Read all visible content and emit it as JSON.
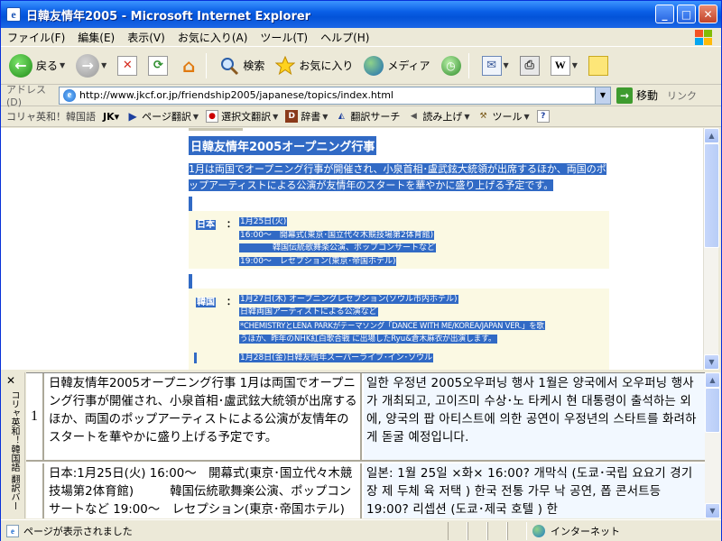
{
  "window": {
    "title": "日韓友情年2005 - Microsoft Internet Explorer",
    "app_icon": "ie-page-icon",
    "minimize": "_",
    "maximize": "□",
    "close": "✕"
  },
  "menu": [
    "ファイル(F)",
    "編集(E)",
    "表示(V)",
    "お気に入り(A)",
    "ツール(T)",
    "ヘルプ(H)"
  ],
  "toolbar": {
    "back_label": "戻る",
    "search_label": "検索",
    "favorites_label": "お気に入り",
    "media_label": "メディア"
  },
  "address": {
    "label": "アドレス(D)",
    "url": "http://www.jkcf.or.jp/friendship2005/japanese/topics/index.html",
    "go_label": "移動",
    "links_label": "リンク"
  },
  "korea_toolbar": {
    "brand": "コリャ英和！韓国語",
    "jk": "JK▾",
    "page_translate": "ページ翻訳",
    "selection_translate": "選択文翻訳",
    "dictionary": "辞書",
    "translate_search": "翻訳サーチ",
    "read_aloud": "読み上げ",
    "tools": "ツール"
  },
  "page": {
    "title": "日韓友情年2005オープニング行事",
    "desc": "1月は両国でオープニング行事が開催され、小泉首相･盧武鉉大統領が出席するほか、両国のポップアーティストによる公演が友情年のスタートを華やかに盛り上げる予定です。",
    "japan": {
      "country": "日本",
      "colon": "：",
      "rows": [
        "1月25日(火)",
        "16:00～　開幕式(東京･国立代々木競技場第2体育館)",
        "　　　　韓国伝統歌舞楽公演、ポップコンサートなど",
        "19:00～　レセプション(東京･帝国ホテル)"
      ]
    },
    "korea": {
      "country": "韓国",
      "colon": "：",
      "rows": [
        "1月27日(木) オープニングレセプション(ソウル市内ホテル)",
        "日韓両国アーティストによる公演など",
        "*CHEMISTRYとLENA PARKがテーマソング「DANCE WITH ME/KOREA/JAPAN VER.」を歌",
        "うほか、昨年のNHK紅白歌合戦 に出場したRyu&倉木麻衣が出演します。",
        "1月28日(金)日韓友情年スーパーライブ･イン･ソウル"
      ]
    }
  },
  "translation_pane": {
    "close": "✕",
    "sidebar_label": "コリャ英和！韓国語 翻訳バー",
    "rows": [
      {
        "num": "1",
        "ja": "日韓友情年2005オープニング行事 1月は両国でオープニング行事が開催され、小泉首相･盧武鉉大統領が出席するほか、両国のポップアーティストによる公演が友情年のスタートを華やかに盛り上げる予定です。",
        "ko": "일한 우정년 2005오우퍼닝 행사 1월은 양국에서 오우퍼닝 행사가 개최되고, 고이즈미 수상･노 타케시 현 대통령이 출석하는 외에, 양국의 팝 아티스트에 의한 공연이 우정년의 스타트를 화려하게 돋굴 예정입니다."
      },
      {
        "num": "",
        "ja": "日本:1月25日(火) 16:00～　開幕式(東京･国立代々木競技場第2体育館)　　　韓国伝統歌舞楽公演、ポップコンサートなど 19:00～　レセプション(東京･帝国ホテル)",
        "ko": "일본: 1월 25일 ×화× 16:00? 개막식 (도쿄･국립 요요기 경기장 제 두체 육 저택 ) 한국 전통 가무 낙 공연, 폽 콘서트등 19:00? 리셉션 (도쿄･제국 호텔 ) 한"
      }
    ]
  },
  "status": {
    "text": "ページが表示されました",
    "zone": "インターネット"
  }
}
